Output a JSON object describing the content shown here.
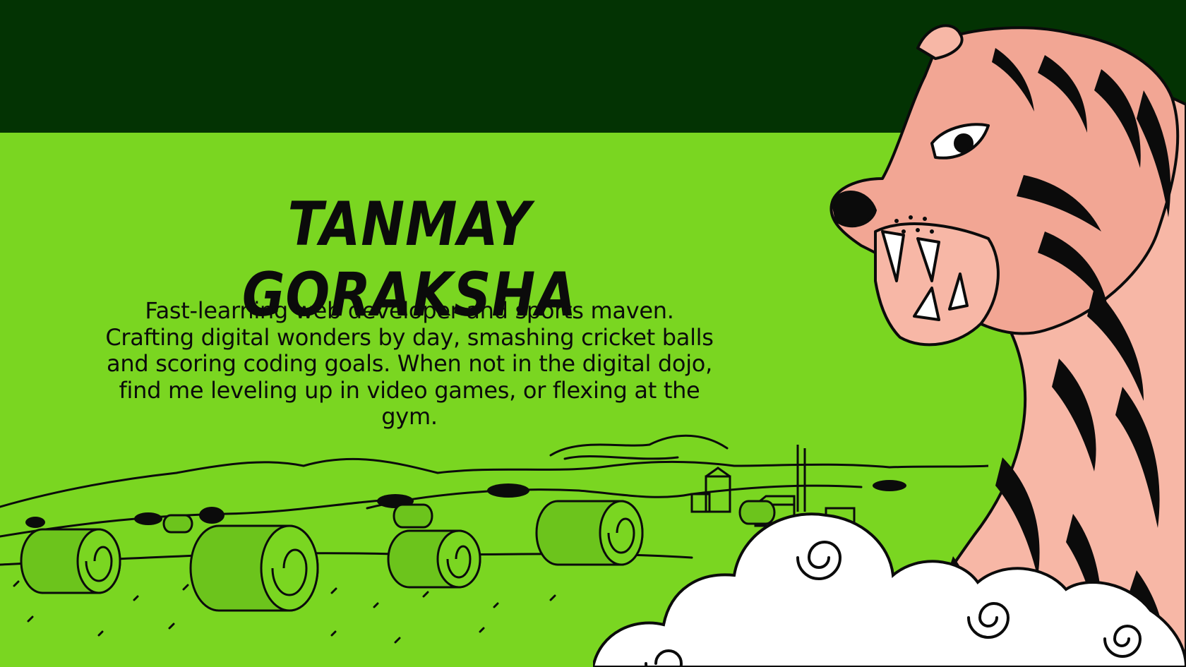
{
  "profile": {
    "name": "TANMAY GORAKSHA",
    "bio": "Fast-learning web developer and sports maven. Crafting digital wonders by day, smashing cricket balls and scoring coding goals. When not in the digital dojo, find me leveling up in video games, or flexing at the gym."
  },
  "colors": {
    "top_band": "#033303",
    "field_green": "#7ad621",
    "ink": "#0b0b0b",
    "tiger_pink": "#f3a796",
    "cloud_white": "#ffffff"
  },
  "illustrations": {
    "landscape": "farm-landscape-illustration",
    "tiger": "tiger-illustration",
    "clouds": "cloud-swirl-illustration"
  }
}
